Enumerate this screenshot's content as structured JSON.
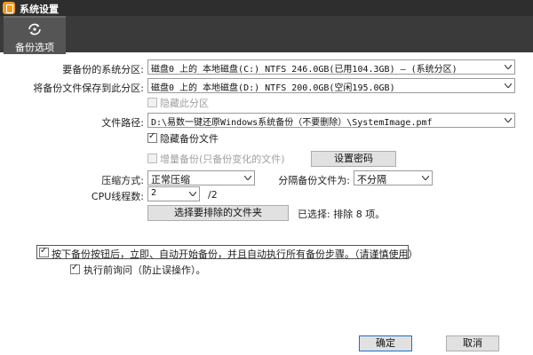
{
  "window": {
    "title": "系统设置"
  },
  "toolbar": {
    "tab_label": "备份选项"
  },
  "form": {
    "source_partition": {
      "label": "要备份的系统分区:",
      "value": "磁盘0 上的 本地磁盘(C:) NTFS 246.0GB(已用104.3GB) — (系统分区)"
    },
    "dest_partition": {
      "label": "将备份文件保存到此分区:",
      "value": "磁盘0 上的 本地磁盘(D:) NTFS 200.0GB(空闲195.0GB)"
    },
    "hide_partition": {
      "label": "隐藏此分区",
      "checked": false,
      "enabled": false
    },
    "file_path": {
      "label": "文件路径:",
      "value": "D:\\易数一键还原Windows系统备份（不要删除）\\SystemImage.pmf"
    },
    "hide_backup_file": {
      "label": "隐藏备份文件",
      "checked": true
    },
    "incremental": {
      "label": "增量备份(只备份变化的文件)",
      "checked": false,
      "enabled": false
    },
    "set_password_button": "设置密码",
    "compression": {
      "label": "压缩方式:",
      "value": "正常压缩"
    },
    "split": {
      "label": "分隔备份文件为:",
      "value": "不分隔"
    },
    "cpu_threads": {
      "label": "CPU线程数:",
      "value": "2",
      "suffix": "/2"
    },
    "exclude_folders_button": "选择要排除的文件夹",
    "exclude_status": "已选择: 排除 8 项。",
    "auto_start": {
      "label": "按下备份按钮后，立即、自动开始备份，并且自动执行所有备份步骤。（请谨慎使用）",
      "checked": true
    },
    "confirm_before": {
      "label": "执行前询问（防止误操作）。",
      "checked": true
    }
  },
  "footer": {
    "ok_label": "确定",
    "cancel_label": "取消"
  },
  "colors": {
    "titlebar": "#2e2e2e",
    "toolbar": "#3a3a3a",
    "tab_active": "#555555",
    "app_icon": "#f39a1e",
    "primary_border": "#1a6fd0"
  },
  "icons": {
    "app": "app-logo-icon",
    "tab": "backup-sync-icon",
    "dropdown": "chevron-down-icon"
  }
}
